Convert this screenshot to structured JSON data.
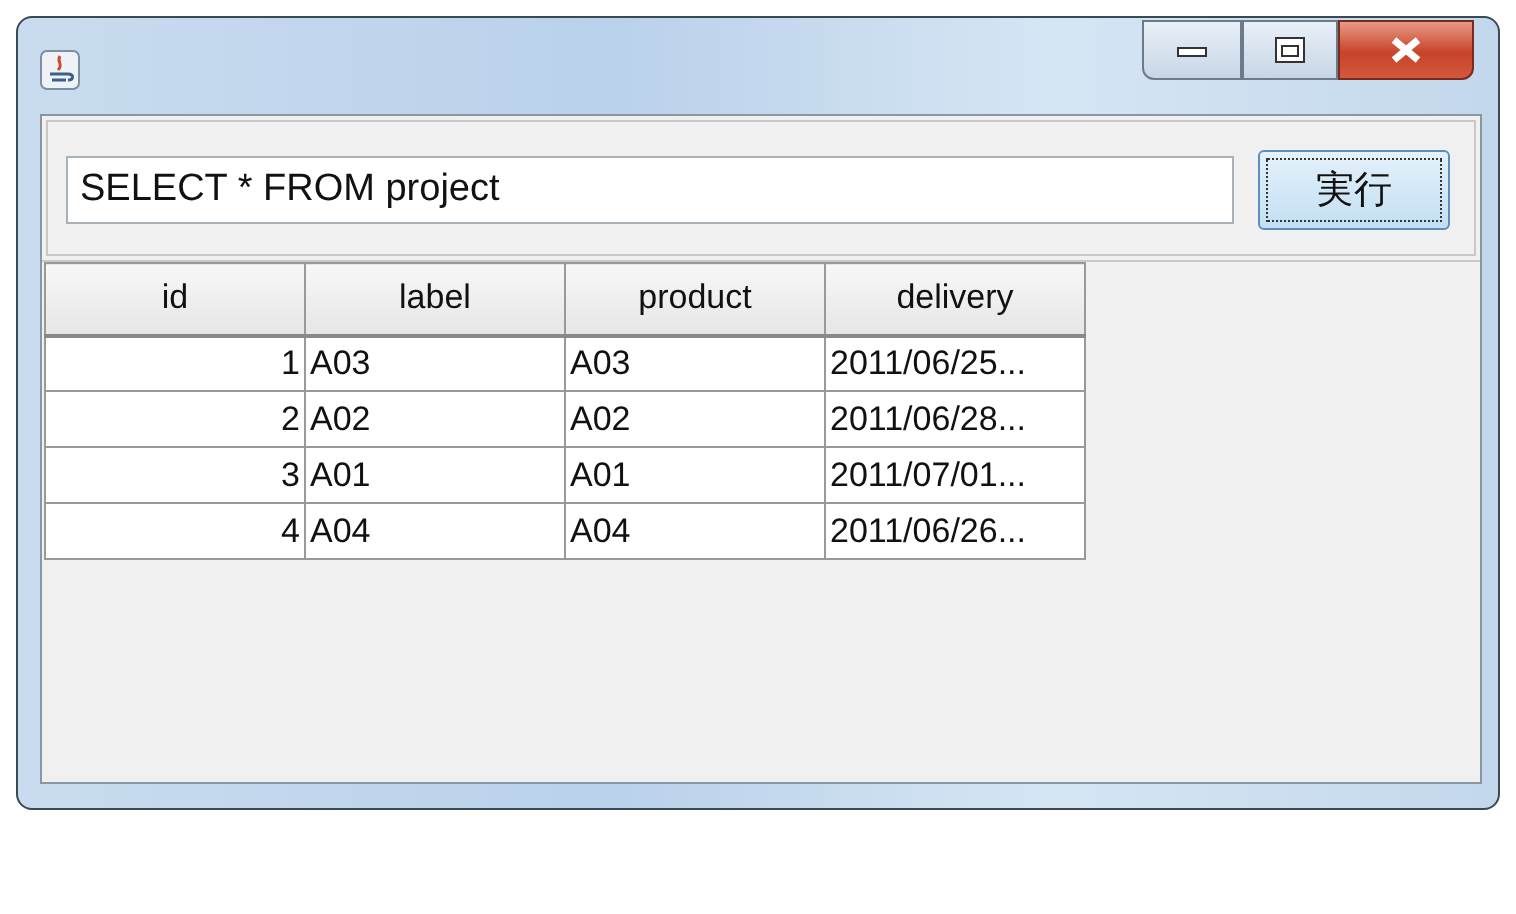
{
  "query_field": {
    "value": "SELECT * FROM project"
  },
  "run_button": {
    "label": "実行"
  },
  "table": {
    "columns": [
      "id",
      "label",
      "product",
      "delivery"
    ],
    "rows": [
      {
        "cells": [
          "1",
          "A03",
          "A03",
          "2011/06/25..."
        ]
      },
      {
        "cells": [
          "2",
          "A02",
          "A02",
          "2011/06/28..."
        ]
      },
      {
        "cells": [
          "3",
          "A01",
          "A01",
          "2011/07/01..."
        ]
      },
      {
        "cells": [
          "4",
          "A04",
          "A04",
          "2011/06/26..."
        ]
      }
    ]
  }
}
